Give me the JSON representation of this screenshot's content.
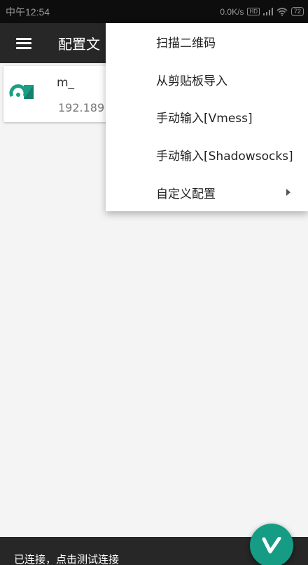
{
  "status_bar": {
    "time": "中午12:54",
    "network_speed": "0.0K/s",
    "box_label": "HD",
    "battery": "72"
  },
  "app_bar": {
    "title": "配置文",
    "menu_icon": "hamburger-menu-icon"
  },
  "server_card": {
    "name": "m_",
    "address": "192.189",
    "icon": "v2ray-server-icon"
  },
  "popup_menu": {
    "items": [
      {
        "label": "扫描二维码"
      },
      {
        "label": "从剪贴板导入"
      },
      {
        "label": "手动输入[Vmess]"
      },
      {
        "label": "手动输入[Shadowsocks]"
      },
      {
        "label": "自定义配置"
      }
    ]
  },
  "bottom_bar": {
    "status_text": "已连接，点击测试连接"
  },
  "fab": {
    "icon": "v-logo-icon"
  },
  "colors": {
    "app_bar_bg": "#272727",
    "accent": "#169c85",
    "status_bar_bg": "#0d0d0d"
  }
}
